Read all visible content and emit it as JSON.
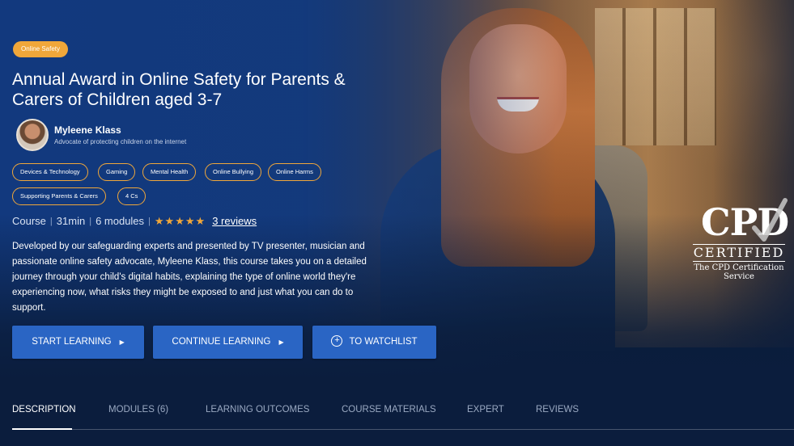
{
  "hero": {
    "badge": "Online Safety",
    "title": "Annual Award in Online Safety for Parents & Carers of Children aged 3-7",
    "presenter": {
      "name": "Myleene Klass",
      "role": "Advocate of protecting children on the internet"
    },
    "tags": [
      "Devices & Technology",
      "Gaming",
      "Mental Health",
      "Online Bullying",
      "Online Harms",
      "Supporting Parents & Carers",
      "4 Cs"
    ],
    "meta": {
      "type": "Course",
      "duration": "31min",
      "modules": "6 modules",
      "stars": "★★★★★",
      "rating": 5,
      "reviews": "3 reviews"
    },
    "description": "Developed by our safeguarding experts and presented by TV presenter, musician and passionate online safety advocate, Myleene Klass, this course takes you on a detailed journey through your child's digital habits, explaining the type of online world they're experiencing now, what risks they might be exposed to and just what you can do to support.",
    "buttons": {
      "start": "START LEARNING",
      "continue": "CONTINUE LEARNING",
      "watchlist": "TO WATCHLIST"
    }
  },
  "cpd": {
    "logo": "CPD",
    "certified": "CERTIFIED",
    "service_line1": "The CPD Certification",
    "service_line2": "Service"
  },
  "tabs": [
    "DESCRIPTION",
    "MODULES (6)",
    "LEARNING OUTCOMES",
    "COURSE MATERIALS",
    "EXPERT",
    "REVIEWS"
  ],
  "colors": {
    "accent": "#f0a73a",
    "button": "#2a65c4",
    "hero_blue": "#123a80",
    "dark_navy": "#0b1d3d"
  }
}
